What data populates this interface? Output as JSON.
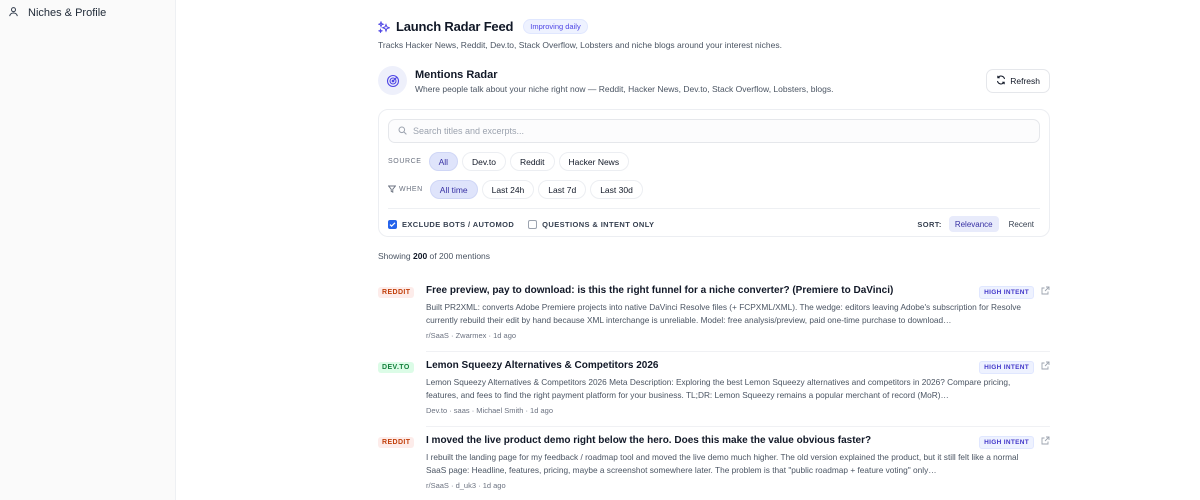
{
  "sidebar": {
    "item_label": "Niches & Profile"
  },
  "header": {
    "title": "Launch Radar Feed",
    "badge": "Improving daily",
    "subtitle": "Tracks Hacker News, Reddit, Dev.to, Stack Overflow, Lobsters and niche blogs around your interest niches."
  },
  "radar": {
    "title": "Mentions Radar",
    "subtitle": "Where people talk about your niche right now — Reddit, Hacker News, Dev.to, Stack Overflow, Lobsters, blogs.",
    "refresh_label": "Refresh"
  },
  "filters": {
    "search_placeholder": "Search titles and excerpts...",
    "source_label": "SOURCE",
    "source_options": [
      "All",
      "Dev.to",
      "Reddit",
      "Hacker News"
    ],
    "source_selected": "All",
    "when_label": "WHEN",
    "when_options": [
      "All time",
      "Last 24h",
      "Last 7d",
      "Last 30d"
    ],
    "when_selected": "All time",
    "exclude_bots_label": "EXCLUDE BOTS / AUTOMOD",
    "exclude_bots_checked": true,
    "questions_label": "QUESTIONS & INTENT ONLY",
    "questions_checked": false,
    "sort_label": "SORT:",
    "sort_options": [
      "Relevance",
      "Recent"
    ],
    "sort_selected": "Relevance"
  },
  "results": {
    "showing_prefix": "Showing",
    "shown_count": "200",
    "showing_mid": "of 200 mentions"
  },
  "mentions": [
    {
      "source": "REDDIT",
      "title": "Free preview, pay to download: is this the right funnel for a niche converter? (Premiere to DaVinci)",
      "intent": "HIGH INTENT",
      "excerpt": "Built PR2XML: converts Adobe Premiere projects into native DaVinci Resolve files (+ FCPXML/XML). The wedge: editors leaving Adobe's subscription for Resolve currently rebuild their edit by hand because XML interchange is unreliable. Model: free analysis/preview, paid one-time purchase to download…",
      "meta": "r/SaaS · Zwarmex · 1d ago"
    },
    {
      "source": "DEV.TO",
      "title": "Lemon Squeezy Alternatives & Competitors 2026",
      "intent": "HIGH INTENT",
      "excerpt": "Lemon Squeezy Alternatives & Competitors 2026 Meta Description: Exploring the best Lemon Squeezy alternatives and competitors in 2026? Compare pricing, features, and fees to find the right payment platform for your business. TL;DR: Lemon Squeezy remains a popular merchant of record (MoR)…",
      "meta": "Dev.to · saas · Michael Smith · 1d ago"
    },
    {
      "source": "REDDIT",
      "title": "I moved the live product demo right below the hero. Does this make the value obvious faster?",
      "intent": "HIGH INTENT",
      "excerpt": "I rebuilt the landing page for my feedback / roadmap tool and moved the live demo much higher. The old version explained the product, but it still felt like a normal SaaS page: Headline, features, pricing, maybe a screenshot somewhere later. The problem is that \"public roadmap + feature voting\" only…",
      "meta": "r/SaaS · d_uk3 · 1d ago"
    }
  ],
  "colors": {
    "accent": "#4f46e5",
    "chip_active_bg": "#dfe4fb",
    "reddit": "#c2410c",
    "devto": "#15803d",
    "checkbox": "#2563eb"
  }
}
